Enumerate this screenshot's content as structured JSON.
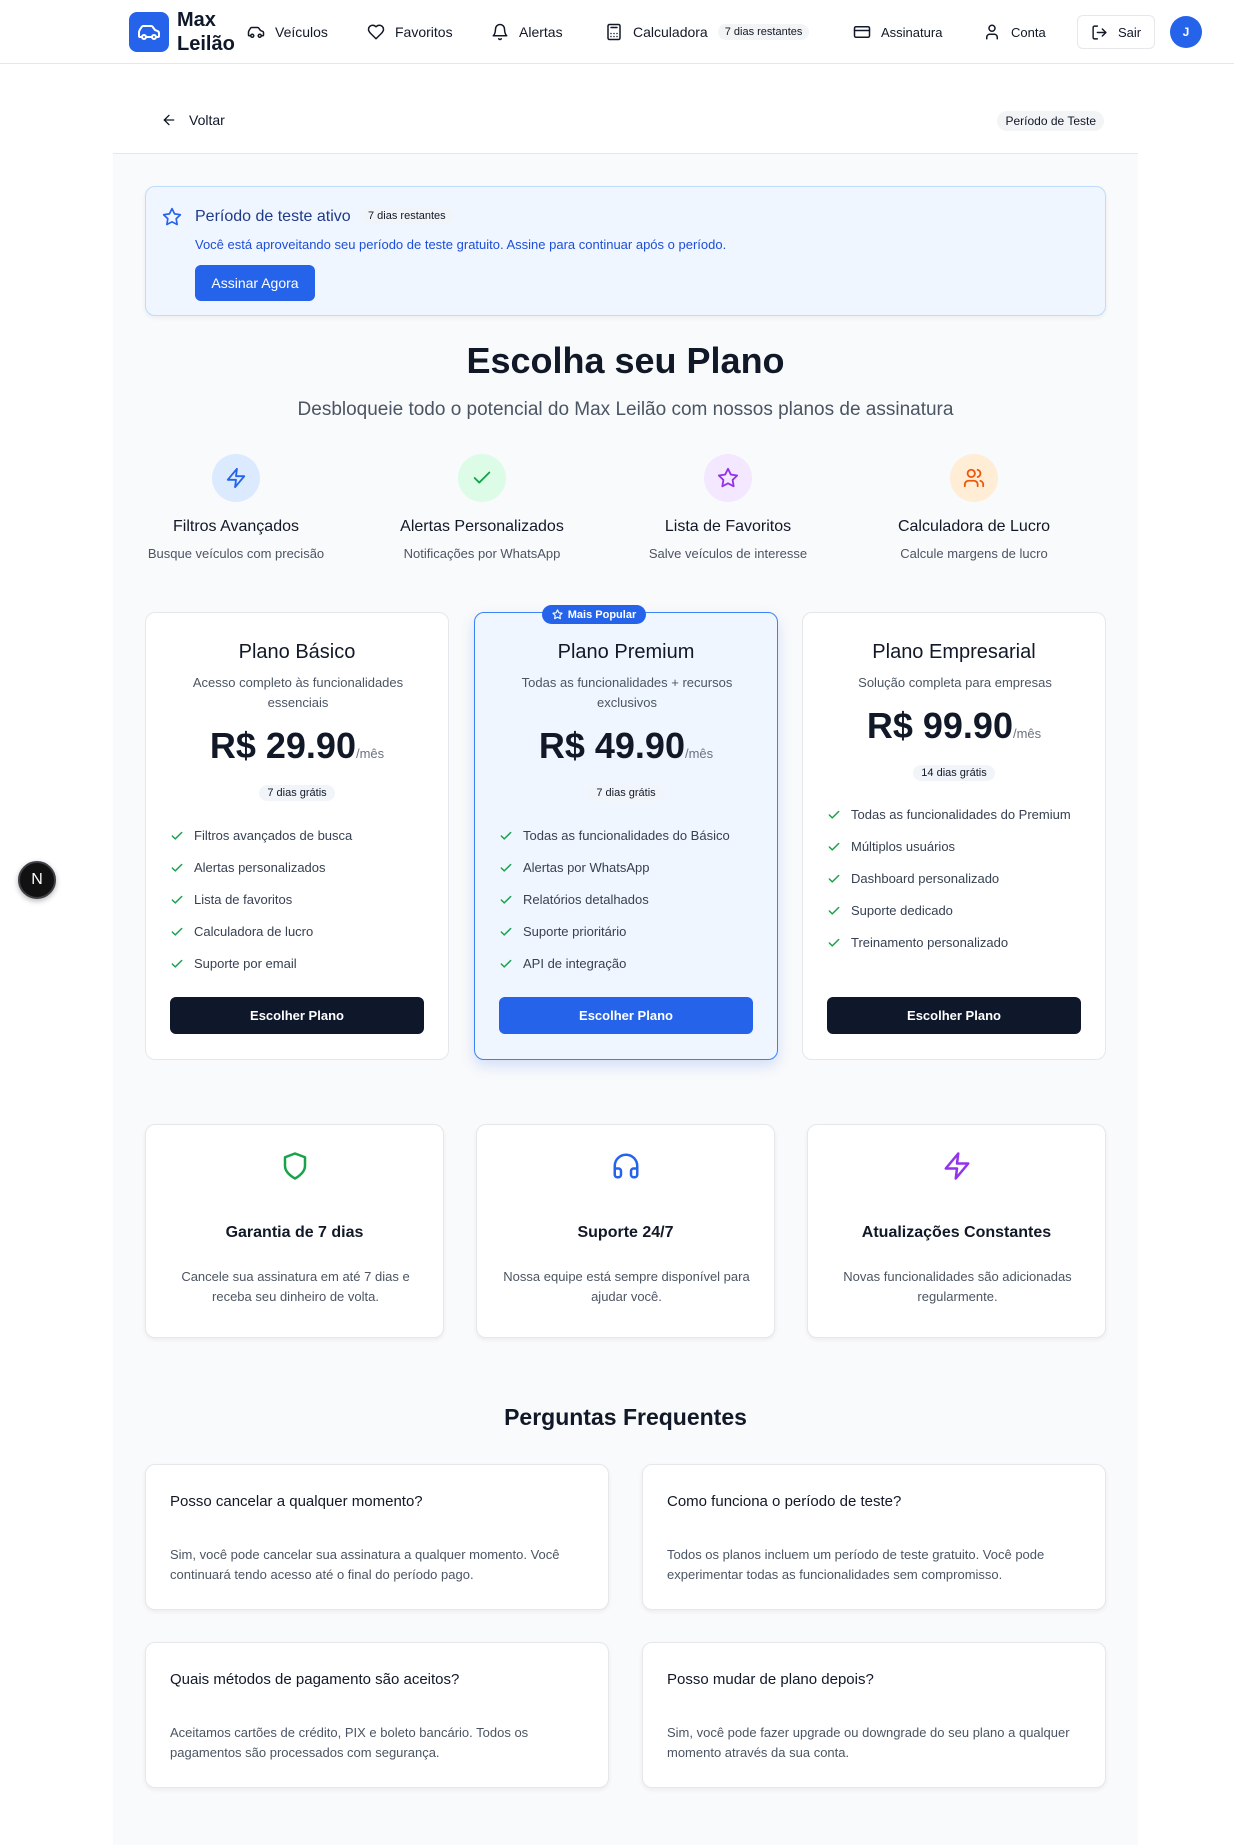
{
  "brand": {
    "name": "Max Leilão",
    "accent": "#2563eb"
  },
  "nav": {
    "items": [
      {
        "label": "Veículos",
        "icon": "car-icon"
      },
      {
        "label": "Favoritos",
        "icon": "heart-icon"
      },
      {
        "label": "Alertas",
        "icon": "bell-icon"
      },
      {
        "label": "Calculadora",
        "icon": "calculator-icon",
        "badge": "7 dias restantes"
      },
      {
        "label": "Assinatura",
        "icon": "credit-card-icon"
      },
      {
        "label": "Conta",
        "icon": "user-icon"
      }
    ],
    "logout_label": "Sair",
    "avatar_initial": "J"
  },
  "subheader": {
    "back_label": "Voltar",
    "status_pill": "Período de Teste"
  },
  "trial_banner": {
    "title": "Período de teste ativo",
    "badge": "7 dias restantes",
    "text": "Você está aproveitando seu período de teste gratuito. Assine para continuar após o período.",
    "button": "Assinar Agora"
  },
  "hero": {
    "title": "Escolha seu Plano",
    "subtitle": "Desbloqueie todo o potencial do Max Leilão com nossos planos de assinatura"
  },
  "features": [
    {
      "title": "Filtros Avançados",
      "desc": "Busque veículos com precisão",
      "icon": "zap-icon",
      "color": "#2563eb",
      "bg": "#dbeafe"
    },
    {
      "title": "Alertas Personalizados",
      "desc": "Notificações por WhatsApp",
      "icon": "check-icon",
      "color": "#16a34a",
      "bg": "#dcfce7"
    },
    {
      "title": "Lista de Favoritos",
      "desc": "Salve veículos de interesse",
      "icon": "star-icon",
      "color": "#9333ea",
      "bg": "#f3e8ff"
    },
    {
      "title": "Calculadora de Lucro",
      "desc": "Calcule margens de lucro",
      "icon": "users-icon",
      "color": "#ea580c",
      "bg": "#ffedd5"
    }
  ],
  "popular_badge": "Mais Popular",
  "plans": [
    {
      "name": "Plano Básico",
      "desc": "Acesso completo às funcionalidades essenciais",
      "price": "R$ 29.90",
      "period": "/mês",
      "trial": "7 dias grátis",
      "features": [
        "Filtros avançados de busca",
        "Alertas personalizados",
        "Lista de favoritos",
        "Calculadora de lucro",
        "Suporte por email"
      ],
      "button": "Escolher Plano"
    },
    {
      "name": "Plano Premium",
      "desc": "Todas as funcionalidades + recursos exclusivos",
      "price": "R$ 49.90",
      "period": "/mês",
      "trial": "7 dias grátis",
      "features": [
        "Todas as funcionalidades do Básico",
        "Alertas por WhatsApp",
        "Relatórios detalhados",
        "Suporte prioritário",
        "API de integração"
      ],
      "button": "Escolher Plano"
    },
    {
      "name": "Plano Empresarial",
      "desc": "Solução completa para empresas",
      "price": "R$ 99.90",
      "period": "/mês",
      "trial": "14 dias grátis",
      "features": [
        "Todas as funcionalidades do Premium",
        "Múltiplos usuários",
        "Dashboard personalizado",
        "Suporte dedicado",
        "Treinamento personalizado"
      ],
      "button": "Escolher Plano"
    }
  ],
  "guarantees": [
    {
      "title": "Garantia de 7 dias",
      "desc": "Cancele sua assinatura em até 7 dias e receba seu dinheiro de volta.",
      "icon": "shield-icon",
      "color": "#16a34a"
    },
    {
      "title": "Suporte 24/7",
      "desc": "Nossa equipe está sempre disponível para ajudar você.",
      "icon": "headphones-icon",
      "color": "#2563eb"
    },
    {
      "title": "Atualizações Constantes",
      "desc": "Novas funcionalidades são adicionadas regularmente.",
      "icon": "zap-icon",
      "color": "#9333ea"
    }
  ],
  "faq": {
    "title": "Perguntas Frequentes",
    "items": [
      {
        "q": "Posso cancelar a qualquer momento?",
        "a": "Sim, você pode cancelar sua assinatura a qualquer momento. Você continuará tendo acesso até o final do período pago."
      },
      {
        "q": "Como funciona o período de teste?",
        "a": "Todos os planos incluem um período de teste gratuito. Você pode experimentar todas as funcionalidades sem compromisso."
      },
      {
        "q": "Quais métodos de pagamento são aceitos?",
        "a": "Aceitamos cartões de crédito, PIX e boleto bancário. Todos os pagamentos são processados com segurança."
      },
      {
        "q": "Posso mudar de plano depois?",
        "a": "Sim, você pode fazer upgrade ou downgrade do seu plano a qualquer momento através da sua conta."
      }
    ]
  },
  "dev_badge": "N"
}
